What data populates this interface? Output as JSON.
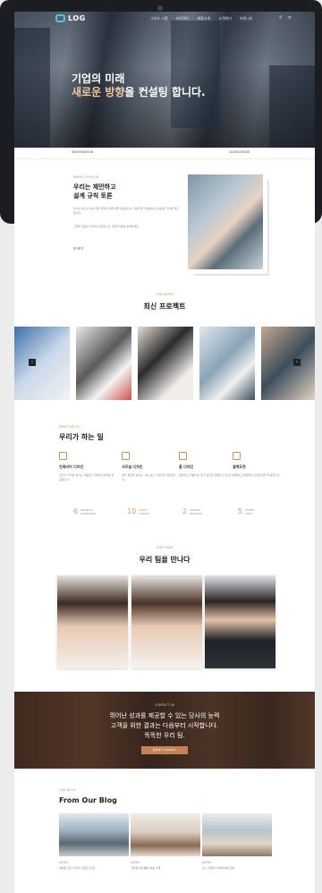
{
  "nav": {
    "logo_text": "LOG",
    "menu": [
      "그리드 그룹",
      "프로젝트",
      "제품소개",
      "고객센터",
      "커뮤니티"
    ],
    "icons": [
      "search-icon",
      "menu-icon"
    ]
  },
  "hero": {
    "title_line1": "기업의 미래",
    "title_line2_pre": "새로운 방향",
    "title_line2_post": "을 컨설팅 합니다.",
    "footer_left": "INFORMATION",
    "footer_right": "LEARN MORE"
  },
  "about": {
    "kicker": "ABOUT OUR JOB",
    "title_line1": "우리는 제안하고",
    "title_line2": "설계 규칙 토론",
    "text1": "당신의 비즈니스를 위한 최적의 솔루션을 제공합니다. 전문적인 컨설팅으로 새로운 가치를 창출합니다.",
    "text2": "고객의 성공이 우리의 성공입니다. 함께 미래를 설계하세요.",
    "more": "더 보기"
  },
  "projects": {
    "kicker": "OUR WORK",
    "title": "최신 프로젝트",
    "prev": "‹",
    "next": "›"
  },
  "services": {
    "kicker": "WHAT WE DO",
    "title": "우리가 하는 일",
    "items": [
      {
        "title": "인테리어 디자인",
        "desc": "공간의 가치를 높이는 맞춤형 인테리어 설계를 제공합니다."
      },
      {
        "title": "사무실 디자인",
        "desc": "업무 효율을 높이는 사무 공간 디자인을 제안합니다."
      },
      {
        "title": "홈 디자인",
        "desc": "편안하고 아름다운 주거 공간을 만들어 드립니다."
      },
      {
        "title": "설계도면",
        "desc": "정확하고 체계적인 설계도면을 작성합니다."
      }
    ],
    "stats": [
      {
        "number": "6",
        "label1": "PROJECTS",
        "label2": "COMPLETED"
      },
      {
        "number": "10",
        "label1": "HAPPY",
        "label2": "CLIENTS"
      },
      {
        "number": "2",
        "label1": "AWARDS",
        "label2": "RECEIVED"
      },
      {
        "number": "5",
        "label1": "EXPERT",
        "label2": "STAFF"
      }
    ]
  },
  "team": {
    "kicker": "OUR TEAM",
    "title": "우리 팀을 만나다"
  },
  "cta": {
    "kicker": "CONTACT US",
    "line1": "뛰어난 성과를 제공할 수 있는 당사의 능력",
    "line2": "고객을 위한 결과는 다음부터 시작합니다.",
    "line3": "똑똑한 우리 팀.",
    "button": "문의하기 CONTACT"
  },
  "blog": {
    "kicker": "OUR BLOG",
    "title": "From Our Blog",
    "posts": [
      {
        "cat": "NEWS",
        "text": "새로운 공간 디자인 트렌드 소개"
      },
      {
        "cat": "NEWS",
        "text": "사무실 리모델링 성공 사례"
      },
      {
        "cat": "NEWS",
        "text": "도시 건축과 인테리어의 조화"
      }
    ]
  },
  "colors": {
    "accent": "#d68b56",
    "logo": "#4fc3d6",
    "dark": "#1c1d21"
  }
}
